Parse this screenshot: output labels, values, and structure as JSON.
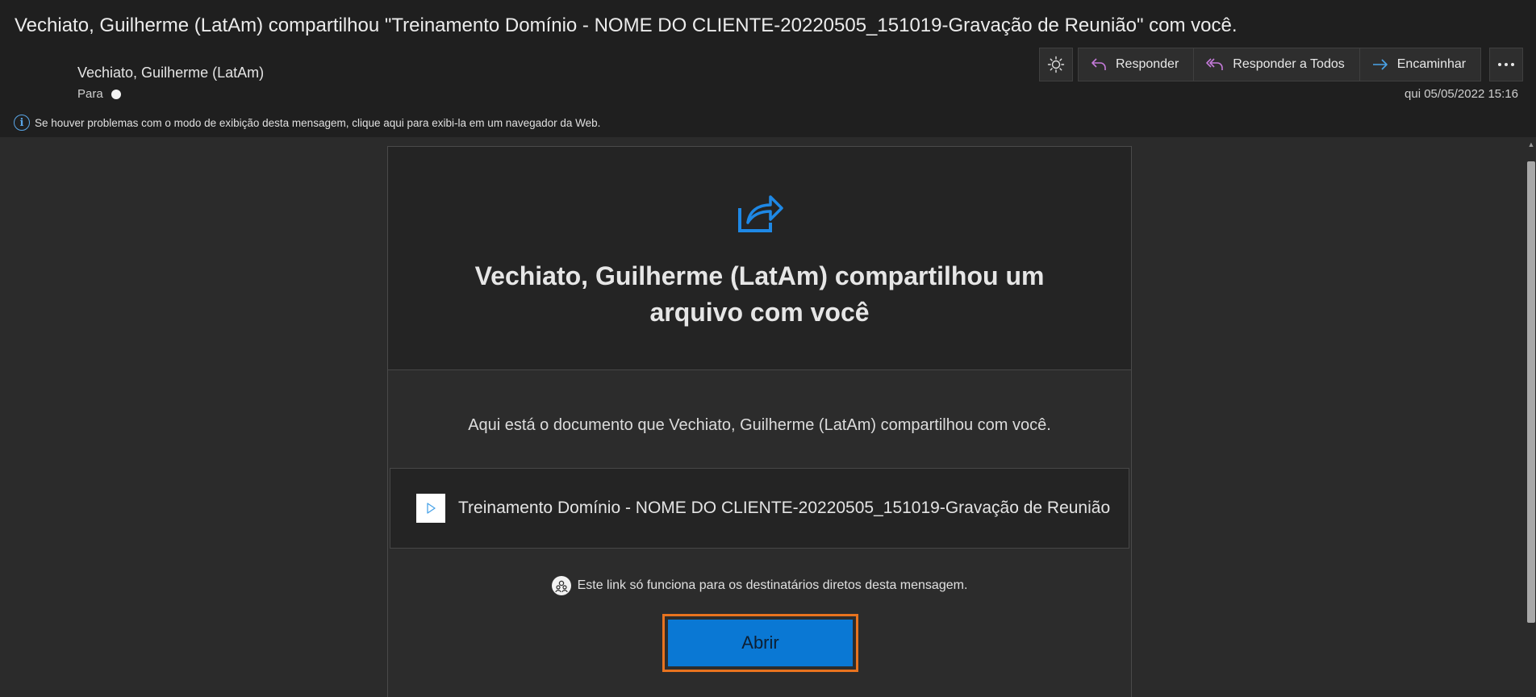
{
  "header": {
    "subject": "Vechiato, Guilherme (LatAm) compartilhou \"Treinamento Domínio - NOME DO CLIENTE-20220505_151019-Gravação de Reunião\" com você.",
    "sender": "Vechiato, Guilherme (LatAm)",
    "to_label": "Para",
    "date": "qui 05/05/2022 15:16"
  },
  "toolbar": {
    "theme_icon": "sun-icon",
    "reply_label": "Responder",
    "reply_all_label": "Responder a Todos",
    "forward_label": "Encaminhar",
    "more_icon": "ellipsis-icon"
  },
  "info_bar": {
    "text": "Se houver problemas com o modo de exibição desta mensagem, clique aqui para exibi-la em um navegador da Web."
  },
  "card": {
    "title": "Vechiato, Guilherme (LatAm) compartilhou um arquivo com você",
    "body": "Aqui está o documento que Vechiato, Guilherme (LatAm) compartilhou com você.",
    "file_name": "Treinamento Domínio - NOME DO CLIENTE-20220505_151019-Gravação de Reunião",
    "notice": "Este link só funciona para os destinatários diretos desta mensagem.",
    "open_label": "Abrir"
  },
  "colors": {
    "accent": "#0a78d4",
    "highlight": "#e8731f",
    "reply_icon": "#c47ad9",
    "forward_icon": "#4aa3e8"
  }
}
